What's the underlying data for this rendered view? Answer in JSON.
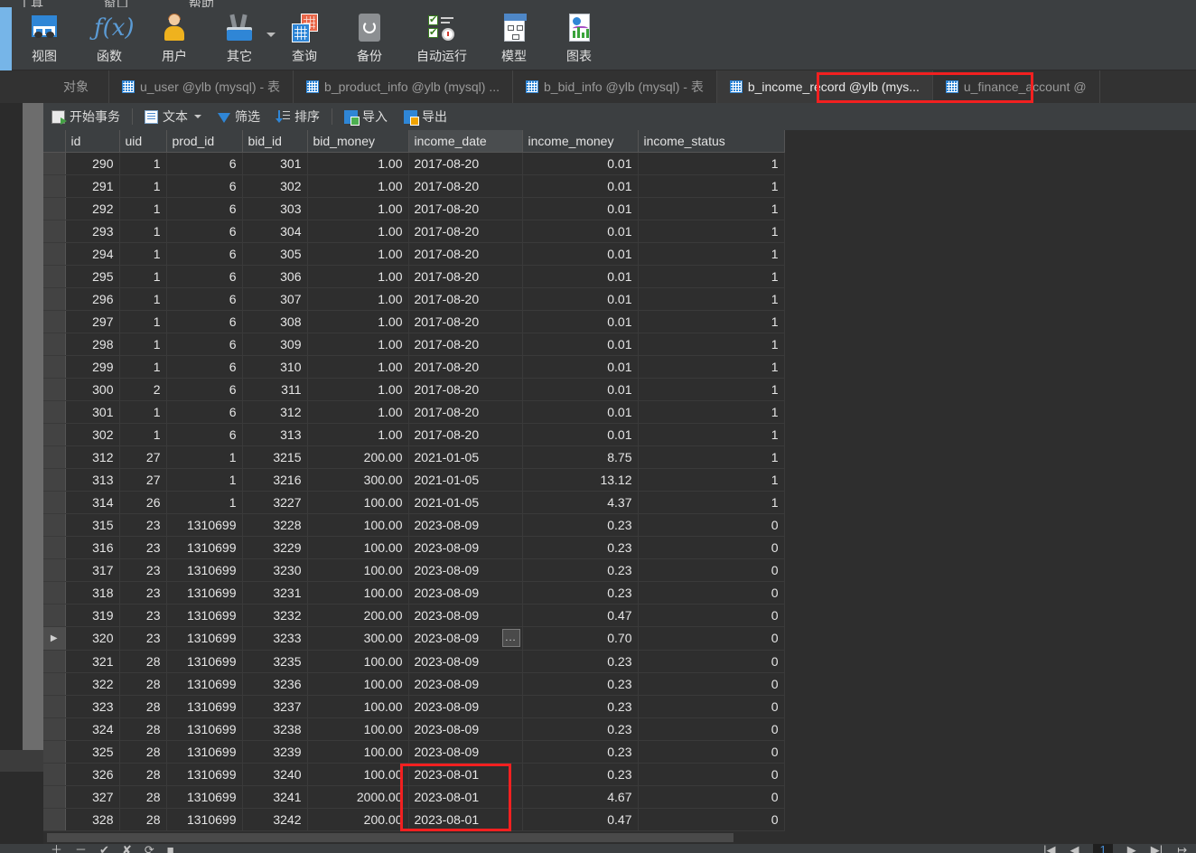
{
  "app": {
    "menu": [
      "工具",
      "窗口",
      "帮助"
    ],
    "accent_color": "#76b5e8",
    "highlight_color": "#f22020"
  },
  "ribbon": {
    "items": [
      {
        "label": "视图",
        "icon": "view-table-icon"
      },
      {
        "label": "函数",
        "icon": "function-fx-icon"
      },
      {
        "label": "用户",
        "icon": "user-icon"
      },
      {
        "label": "其它",
        "icon": "other-tools-icon",
        "has_dropdown": true
      },
      {
        "label": "查询",
        "icon": "query-icon"
      },
      {
        "label": "备份",
        "icon": "backup-icon"
      },
      {
        "label": "自动运行",
        "icon": "automation-icon"
      },
      {
        "label": "模型",
        "icon": "model-icon"
      },
      {
        "label": "图表",
        "icon": "chart-icon"
      }
    ]
  },
  "tabs": {
    "objects_label": "对象",
    "items": [
      {
        "label": "u_user @ylb (mysql) - 表",
        "active": false
      },
      {
        "label": "b_product_info @ylb (mysql) ...",
        "active": false
      },
      {
        "label": "b_bid_info @ylb (mysql) - 表",
        "active": false
      },
      {
        "label": "b_income_record @ylb (mys...",
        "active": true,
        "highlighted": true
      },
      {
        "label": "u_finance_account @",
        "active": false
      }
    ]
  },
  "grid_toolbar": {
    "begin_transaction": "开始事务",
    "text": "文本",
    "filter": "筛选",
    "sort": "排序",
    "import": "导入",
    "export": "导出"
  },
  "table": {
    "columns": [
      "id",
      "uid",
      "prod_id",
      "bid_id",
      "bid_money",
      "income_date",
      "income_money",
      "income_status"
    ],
    "selected_column": "income_date",
    "current_row_index": 21,
    "selected_cell": {
      "row_index": 21,
      "column": "income_date",
      "ellipsis_label": "..."
    },
    "rows": [
      [
        "290",
        "1",
        "6",
        "301",
        "1.00",
        "2017-08-20",
        "0.01",
        "1"
      ],
      [
        "291",
        "1",
        "6",
        "302",
        "1.00",
        "2017-08-20",
        "0.01",
        "1"
      ],
      [
        "292",
        "1",
        "6",
        "303",
        "1.00",
        "2017-08-20",
        "0.01",
        "1"
      ],
      [
        "293",
        "1",
        "6",
        "304",
        "1.00",
        "2017-08-20",
        "0.01",
        "1"
      ],
      [
        "294",
        "1",
        "6",
        "305",
        "1.00",
        "2017-08-20",
        "0.01",
        "1"
      ],
      [
        "295",
        "1",
        "6",
        "306",
        "1.00",
        "2017-08-20",
        "0.01",
        "1"
      ],
      [
        "296",
        "1",
        "6",
        "307",
        "1.00",
        "2017-08-20",
        "0.01",
        "1"
      ],
      [
        "297",
        "1",
        "6",
        "308",
        "1.00",
        "2017-08-20",
        "0.01",
        "1"
      ],
      [
        "298",
        "1",
        "6",
        "309",
        "1.00",
        "2017-08-20",
        "0.01",
        "1"
      ],
      [
        "299",
        "1",
        "6",
        "310",
        "1.00",
        "2017-08-20",
        "0.01",
        "1"
      ],
      [
        "300",
        "2",
        "6",
        "311",
        "1.00",
        "2017-08-20",
        "0.01",
        "1"
      ],
      [
        "301",
        "1",
        "6",
        "312",
        "1.00",
        "2017-08-20",
        "0.01",
        "1"
      ],
      [
        "302",
        "1",
        "6",
        "313",
        "1.00",
        "2017-08-20",
        "0.01",
        "1"
      ],
      [
        "312",
        "27",
        "1",
        "3215",
        "200.00",
        "2021-01-05",
        "8.75",
        "1"
      ],
      [
        "313",
        "27",
        "1",
        "3216",
        "300.00",
        "2021-01-05",
        "13.12",
        "1"
      ],
      [
        "314",
        "26",
        "1",
        "3227",
        "100.00",
        "2021-01-05",
        "4.37",
        "1"
      ],
      [
        "315",
        "23",
        "1310699",
        "3228",
        "100.00",
        "2023-08-09",
        "0.23",
        "0"
      ],
      [
        "316",
        "23",
        "1310699",
        "3229",
        "100.00",
        "2023-08-09",
        "0.23",
        "0"
      ],
      [
        "317",
        "23",
        "1310699",
        "3230",
        "100.00",
        "2023-08-09",
        "0.23",
        "0"
      ],
      [
        "318",
        "23",
        "1310699",
        "3231",
        "100.00",
        "2023-08-09",
        "0.23",
        "0"
      ],
      [
        "319",
        "23",
        "1310699",
        "3232",
        "200.00",
        "2023-08-09",
        "0.47",
        "0"
      ],
      [
        "320",
        "23",
        "1310699",
        "3233",
        "300.00",
        "2023-08-09",
        "0.70",
        "0"
      ],
      [
        "321",
        "28",
        "1310699",
        "3235",
        "100.00",
        "2023-08-09",
        "0.23",
        "0"
      ],
      [
        "322",
        "28",
        "1310699",
        "3236",
        "100.00",
        "2023-08-09",
        "0.23",
        "0"
      ],
      [
        "323",
        "28",
        "1310699",
        "3237",
        "100.00",
        "2023-08-09",
        "0.23",
        "0"
      ],
      [
        "324",
        "28",
        "1310699",
        "3238",
        "100.00",
        "2023-08-09",
        "0.23",
        "0"
      ],
      [
        "325",
        "28",
        "1310699",
        "3239",
        "100.00",
        "2023-08-09",
        "0.23",
        "0"
      ],
      [
        "326",
        "28",
        "1310699",
        "3240",
        "100.00",
        "2023-08-01",
        "0.23",
        "0"
      ],
      [
        "327",
        "28",
        "1310699",
        "3241",
        "2000.00",
        "2023-08-01",
        "4.67",
        "0"
      ],
      [
        "328",
        "28",
        "1310699",
        "3242",
        "200.00",
        "2023-08-01",
        "0.47",
        "0"
      ]
    ]
  },
  "statusbar": {
    "left_icons": [
      "add-record-icon",
      "remove-record-icon",
      "apply-icon",
      "cancel-icon",
      "refresh-icon",
      "stop-icon"
    ],
    "right_icons": [
      "first-page-icon",
      "prev-page-icon",
      "next-page-icon",
      "last-page-icon",
      "goto-icon"
    ],
    "page_number": "1"
  }
}
